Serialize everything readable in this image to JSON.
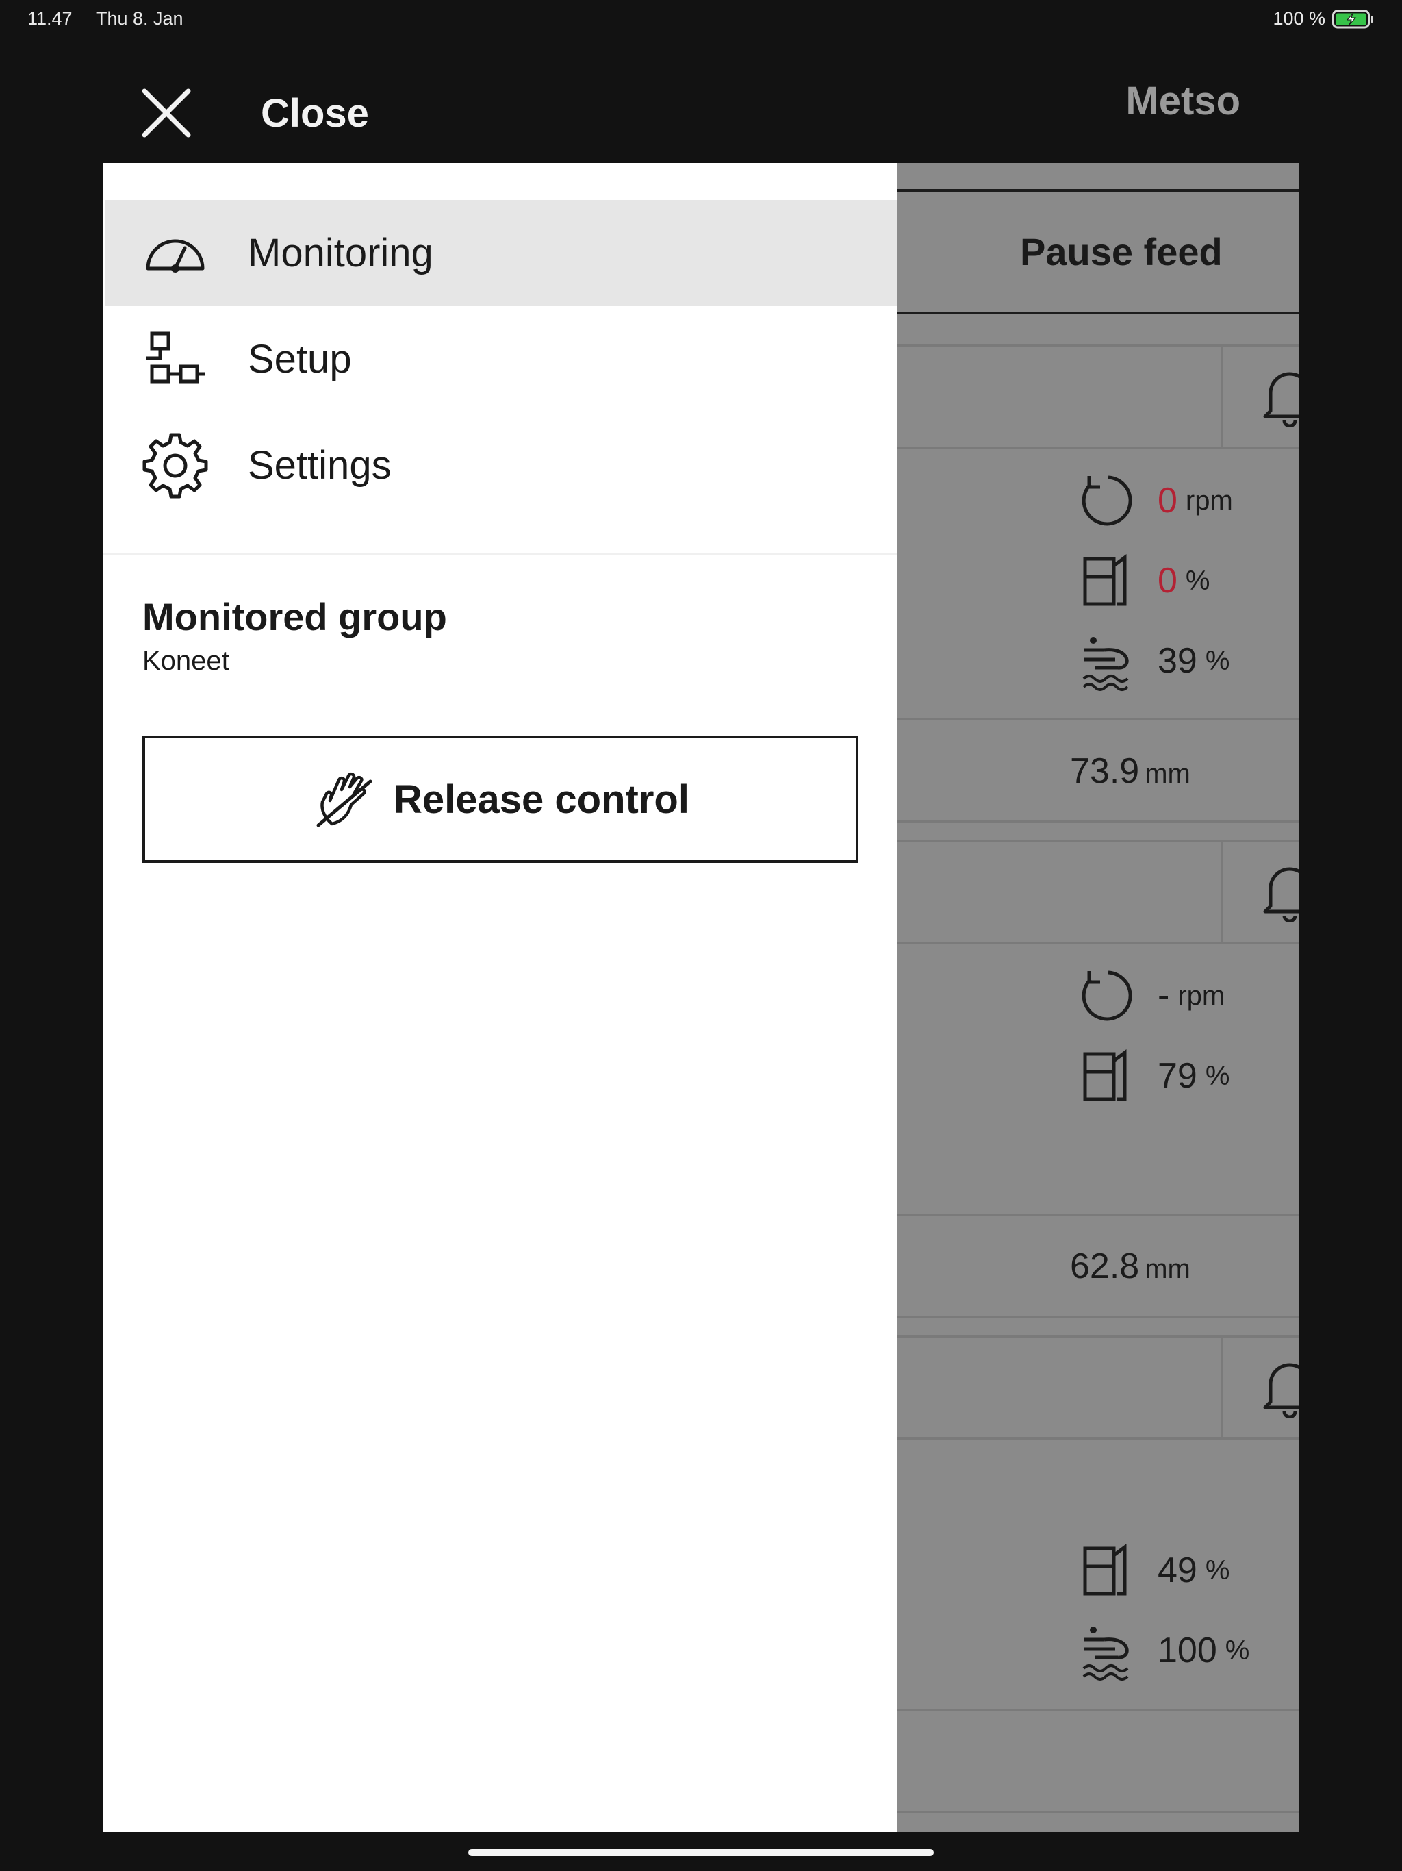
{
  "status_bar": {
    "time": "11.47",
    "date": "Thu 8. Jan",
    "battery_percent": "100 %",
    "battery_color": "#37c34a"
  },
  "header": {
    "close_label": "Close",
    "brand": "Metso"
  },
  "drawer": {
    "nav_items": [
      {
        "label": "Monitoring",
        "icon": "gauge-icon",
        "active": true
      },
      {
        "label": "Setup",
        "icon": "flow-diagram-icon",
        "active": false
      },
      {
        "label": "Settings",
        "icon": "gear-icon",
        "active": false
      }
    ],
    "monitored_group": {
      "title": "Monitored group",
      "name": "Koneet"
    },
    "release_button": {
      "label": "Release control",
      "icon": "hand-off-icon"
    }
  },
  "background": {
    "pause_feed_label": "Pause feed",
    "cards": [
      {
        "metrics": [
          {
            "icon": "rotation-icon",
            "value": "0",
            "unit": "rpm",
            "alert": true
          },
          {
            "icon": "fuel-icon",
            "value": "0",
            "unit": "%",
            "alert": true
          },
          {
            "icon": "water-spray-icon",
            "value": "39",
            "unit": "%",
            "alert": false
          }
        ],
        "footer": {
          "value": "73.9",
          "unit": "mm"
        }
      },
      {
        "metrics": [
          {
            "icon": "rotation-icon",
            "value": "-",
            "unit": "rpm",
            "alert": false
          },
          {
            "icon": "fuel-icon",
            "value": "79",
            "unit": "%",
            "alert": false
          }
        ],
        "footer": {
          "value": "62.8",
          "unit": "mm"
        }
      },
      {
        "metrics": [
          {
            "icon": "fuel-icon",
            "value": "49",
            "unit": "%",
            "alert": false
          },
          {
            "icon": "water-spray-icon",
            "value": "100",
            "unit": "%",
            "alert": false
          }
        ]
      }
    ]
  },
  "colors": {
    "alert_red": "#b32234",
    "drawer_bg": "#ffffff",
    "active_item_bg": "#e6e6e6"
  }
}
